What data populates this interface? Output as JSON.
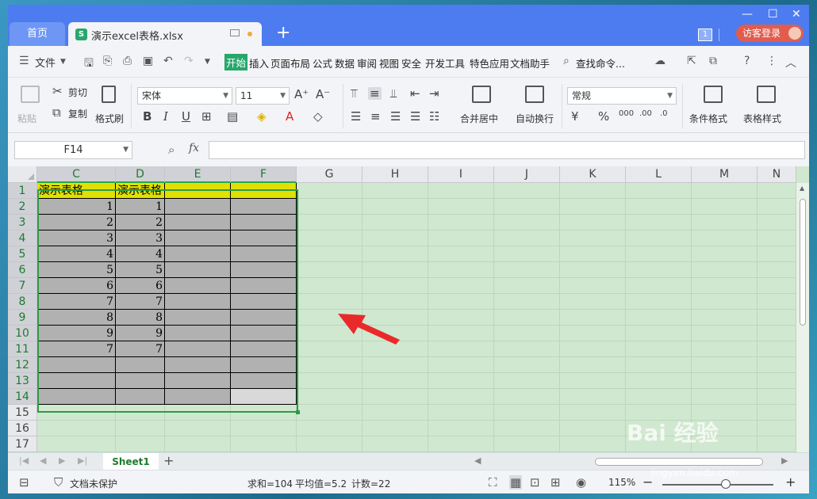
{
  "titlebar": {
    "home_tab": "首页",
    "doc_icon_letter": "S",
    "doc_tab": "演示excel表格.xlsx",
    "new_tab": "+",
    "badge": "1",
    "login": "访客登录",
    "min": "—",
    "max": "☐",
    "close": "✕"
  },
  "menubar": {
    "file": "文件",
    "items": [
      "开始",
      "插入",
      "页面布局",
      "公式",
      "数据",
      "审阅",
      "视图",
      "安全",
      "开发工具",
      "特色应用",
      "文档助手"
    ],
    "search": "查找命令..."
  },
  "ribbon": {
    "paste": "粘贴",
    "cut": "剪切",
    "copy": "复制",
    "format_painter": "格式刷",
    "font_name": "宋体",
    "font_size": "11",
    "merge_center": "合并居中",
    "wrap_text": "自动换行",
    "number_format": "常规",
    "conditional_format": "条件格式",
    "table_style": "表格样式",
    "bold": "B",
    "italic": "I",
    "underline": "U",
    "percent": "%"
  },
  "formulabar": {
    "cell_ref": "F14",
    "fx": "fx",
    "formula": ""
  },
  "grid": {
    "columns": [
      "C",
      "D",
      "E",
      "F",
      "G",
      "H",
      "I",
      "J",
      "K",
      "L",
      "M",
      "N"
    ],
    "rows": [
      "1",
      "2",
      "3",
      "4",
      "5",
      "6",
      "7",
      "8",
      "9",
      "10",
      "11",
      "12",
      "13",
      "14",
      "15",
      "16",
      "17"
    ],
    "header_c": "演示表格",
    "header_d": "演示表格",
    "col_c_values": [
      "1",
      "2",
      "3",
      "4",
      "5",
      "6",
      "7",
      "8",
      "9",
      "7"
    ],
    "col_d_values": [
      "1",
      "2",
      "3",
      "4",
      "5",
      "6",
      "7",
      "8",
      "9",
      "7"
    ],
    "fill_header": "#e1e000",
    "fill_body": "#b1b1b1",
    "sheet_bg": "#d0e8d0"
  },
  "sheetbar": {
    "sheet_name": "Sheet1",
    "add": "+"
  },
  "statusbar": {
    "protect": "文档未保护",
    "sum": "求和=104",
    "average": "平均值=5.2",
    "count": "计数=22",
    "zoom": "115%"
  },
  "watermark": {
    "brand": "Bai 经验",
    "url": "jingyan.baidu.com"
  }
}
